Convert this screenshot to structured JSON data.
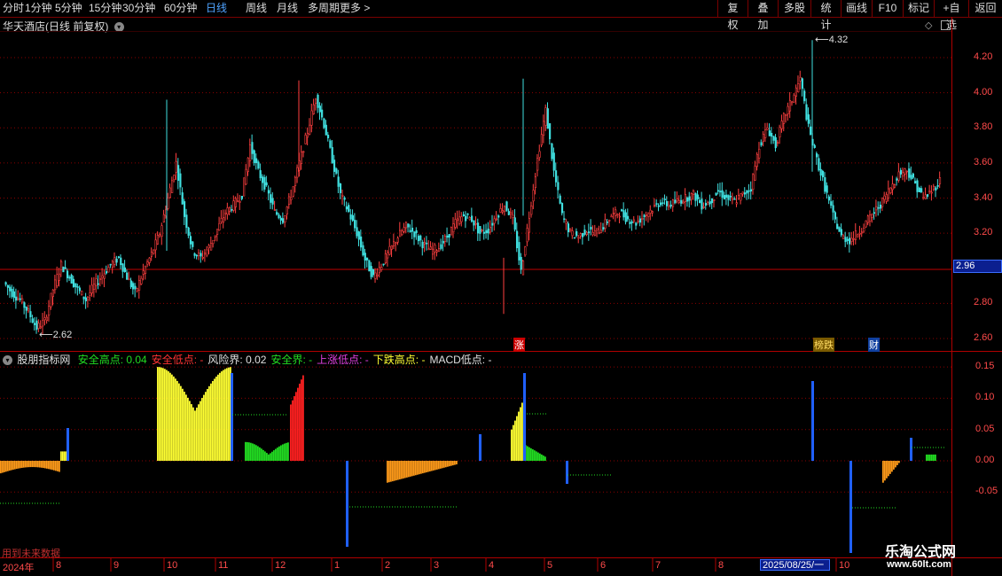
{
  "toolbar": {
    "periods": [
      "分时",
      "1分钟",
      "5分钟",
      "15分钟",
      "30分钟",
      "60分钟",
      "日线",
      "周线",
      "月线",
      "多周期",
      "更多 >"
    ],
    "active_period": "日线",
    "right_buttons": [
      "复权",
      "叠加",
      "多股",
      "统计",
      "画线",
      "F10",
      "标记",
      "+自选",
      "返回"
    ]
  },
  "main_chart": {
    "title": "华天酒店(日线 前复权)",
    "high_label": "4.32",
    "low_label": "2.62",
    "current_price": "2.96",
    "y_ticks": [
      "4.20",
      "4.00",
      "3.80",
      "3.60",
      "3.40",
      "3.20",
      "2.80",
      "2.60"
    ],
    "markers": {
      "zhang": "涨",
      "bang": "榜跌",
      "cai": "财"
    }
  },
  "indicator": {
    "name": "股朋指标网",
    "items": [
      {
        "label": "安全高点:",
        "value": "0.04",
        "color": "#22dd22"
      },
      {
        "label": "安全低点:",
        "value": "-",
        "color": "#ff3333"
      },
      {
        "label": "风险界:",
        "value": "0.02",
        "color": "#e0e0e0"
      },
      {
        "label": "安全界:",
        "value": "-",
        "color": "#22dd22"
      },
      {
        "label": "上涨低点:",
        "value": "-",
        "color": "#e040e0"
      },
      {
        "label": "下跌高点:",
        "value": "-",
        "color": "#ffff33"
      },
      {
        "label": "MACD低点:",
        "value": "-",
        "color": "#e0e0e0"
      }
    ],
    "y_ticks": [
      "0.15",
      "0.10",
      "0.05",
      "0.00",
      "-0.05"
    ],
    "footnote": "用到未来数据"
  },
  "dates": {
    "year": "2024年",
    "months": [
      "8",
      "9",
      "10",
      "11",
      "12",
      "1",
      "2",
      "3",
      "4",
      "5",
      "6",
      "7",
      "8",
      "10"
    ],
    "cursor_date": "2025/08/25/一"
  },
  "watermark": {
    "line1": "乐淘公式网",
    "line2": "www.60lt.com"
  },
  "colors": {
    "up": "#ff4040",
    "down": "#40e0e0",
    "grid": "#8a0000"
  },
  "chart_data": {
    "type": "candlestick",
    "title": "华天酒店(日线 前复权)",
    "ylim": [
      2.55,
      4.35
    ],
    "y_ticks": [
      2.6,
      2.8,
      3.2,
      3.4,
      3.6,
      3.8,
      4.0,
      4.2
    ],
    "annotations": [
      {
        "label": "4.32",
        "value": 4.32
      },
      {
        "label": "2.62",
        "value": 2.62
      },
      {
        "label": "2.96",
        "value": 2.96
      }
    ],
    "close_path": [
      2.92,
      2.86,
      2.82,
      2.75,
      2.66,
      2.7,
      2.88,
      3.02,
      2.95,
      2.88,
      2.82,
      2.9,
      2.96,
      3.02,
      3.06,
      2.95,
      2.86,
      2.98,
      3.08,
      3.2,
      3.4,
      3.6,
      3.3,
      3.1,
      3.06,
      3.12,
      3.22,
      3.32,
      3.36,
      3.42,
      3.7,
      3.55,
      3.45,
      3.32,
      3.28,
      3.42,
      3.6,
      3.78,
      3.98,
      3.82,
      3.62,
      3.42,
      3.32,
      3.2,
      3.05,
      2.95,
      3.02,
      3.1,
      3.18,
      3.24,
      3.2,
      3.14,
      3.1,
      3.12,
      3.18,
      3.26,
      3.3,
      3.28,
      3.2,
      3.22,
      3.3,
      3.36,
      3.28,
      2.98,
      3.3,
      3.62,
      3.9,
      3.55,
      3.3,
      3.2,
      3.18,
      3.22,
      3.2,
      3.24,
      3.3,
      3.32,
      3.28,
      3.26,
      3.3,
      3.34,
      3.38,
      3.36,
      3.38,
      3.4,
      3.42,
      3.36,
      3.38,
      3.44,
      3.4,
      3.38,
      3.42,
      3.46,
      3.7,
      3.8,
      3.7,
      3.86,
      3.96,
      4.08,
      3.8,
      3.62,
      3.46,
      3.3,
      3.18,
      3.16,
      3.2,
      3.26,
      3.32,
      3.38,
      3.46,
      3.54,
      3.56,
      3.48,
      3.4,
      3.44,
      3.5
    ],
    "indicator": {
      "type": "bar",
      "ylim": [
        -0.08,
        0.16
      ],
      "y_ticks": [
        0.15,
        0.1,
        0.05,
        0.0,
        -0.05
      ],
      "series": [
        {
          "name": "安全高点",
          "values": [
            0.04
          ]
        },
        {
          "name": "风险界",
          "values": [
            0.02
          ]
        }
      ]
    }
  }
}
